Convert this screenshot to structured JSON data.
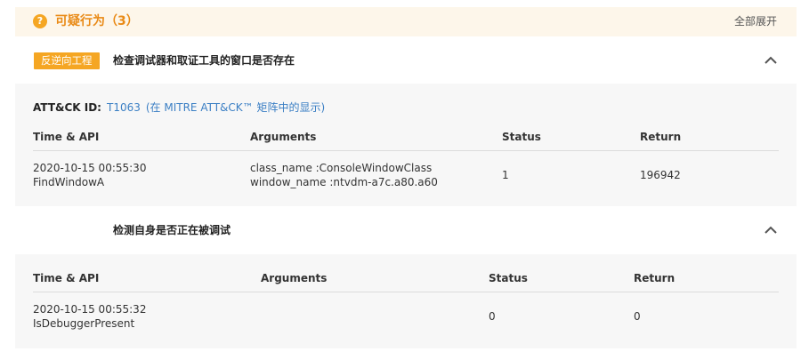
{
  "header": {
    "icon": "question-circle-icon",
    "icon_glyph": "?",
    "title": "可疑行为（3）",
    "expand_all": "全部展开"
  },
  "sections": [
    {
      "tag": "反逆向工程",
      "title": "检查调试器和取证工具的窗口是否存在",
      "caret": "chevron-up-icon",
      "attck_label": "ATT&CK ID:",
      "attck_id": "T1063",
      "attck_matrix": "(在 MITRE ATT&CK™ 矩阵中的显示)",
      "columns": [
        "Time & API",
        "Arguments",
        "Status",
        "Return"
      ],
      "rows": [
        {
          "time": "2020-10-15 00:55:30",
          "api": "FindWindowA",
          "arguments": [
            "class_name :ConsoleWindowClass",
            "window_name :ntvdm-a7c.a80.a60"
          ],
          "status": "1",
          "return": "196942"
        }
      ]
    },
    {
      "tag": "",
      "title": "检测自身是否正在被调试",
      "caret": "chevron-up-icon",
      "columns": [
        "Time & API",
        "Arguments",
        "Status",
        "Return"
      ],
      "rows": [
        {
          "time": "2020-10-15 00:55:32",
          "api": "IsDebuggerPresent",
          "arguments": [],
          "status": "0",
          "return": "0"
        }
      ]
    }
  ],
  "colors": {
    "accent": "#f5a623",
    "title_orange": "#e98a16",
    "header_bg": "#fdf6ea",
    "link": "#3b7fc4",
    "body_bg": "#f7f7f7"
  }
}
